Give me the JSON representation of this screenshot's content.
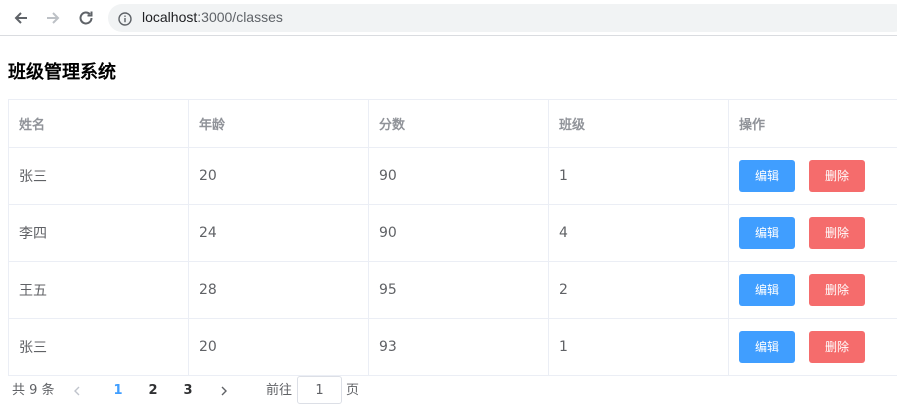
{
  "browser": {
    "url_host": "localhost",
    "url_path": ":3000/classes"
  },
  "page": {
    "title": "班级管理系统"
  },
  "table": {
    "headers": [
      "姓名",
      "年龄",
      "分数",
      "班级",
      "操作"
    ],
    "rows": [
      {
        "name": "张三",
        "age": "20",
        "score": "90",
        "class": "1"
      },
      {
        "name": "李四",
        "age": "24",
        "score": "90",
        "class": "4"
      },
      {
        "name": "王五",
        "age": "28",
        "score": "95",
        "class": "2"
      },
      {
        "name": "张三",
        "age": "20",
        "score": "93",
        "class": "1"
      }
    ],
    "edit_label": "编辑",
    "delete_label": "删除"
  },
  "pagination": {
    "total_text": "共 9 条",
    "pages": [
      "1",
      "2",
      "3"
    ],
    "current_page": "1",
    "goto_label": "前往",
    "goto_value": "1",
    "page_label": "页"
  },
  "colors": {
    "primary": "#409eff",
    "danger": "#f56c6c",
    "border": "#ebeef5"
  }
}
